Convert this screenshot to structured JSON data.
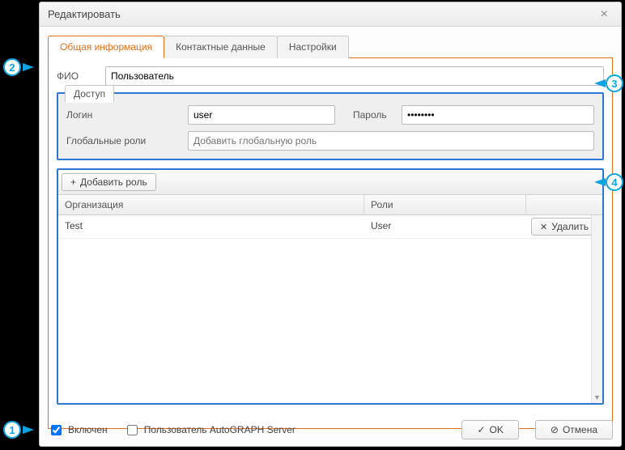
{
  "dialog": {
    "title": "Редактировать"
  },
  "tabs": {
    "general": "Общая информация",
    "contact": "Контактные данные",
    "settings": "Настройки"
  },
  "fio": {
    "label": "ФИО",
    "value": "Пользователь"
  },
  "access": {
    "legend": "Доступ",
    "login_label": "Логин",
    "login_value": "user",
    "password_label": "Пароль",
    "password_value": "••••••••",
    "global_roles_label": "Глобальные роли",
    "global_roles_placeholder": "Добавить глобальную роль"
  },
  "roles": {
    "add_button": "Добавить роль",
    "col_org": "Организация",
    "col_role": "Роли",
    "rows": [
      {
        "org": "Test",
        "role": "User"
      }
    ],
    "delete_label": "Удалить"
  },
  "footer": {
    "enabled_label": "Включен",
    "enabled_checked": true,
    "autograph_label": "Пользователь AutoGRAPH Server",
    "autograph_checked": false,
    "ok": "OK",
    "cancel": "Отмена"
  },
  "markers": {
    "m1": "1",
    "m2": "2",
    "m3": "3",
    "m4": "4"
  }
}
